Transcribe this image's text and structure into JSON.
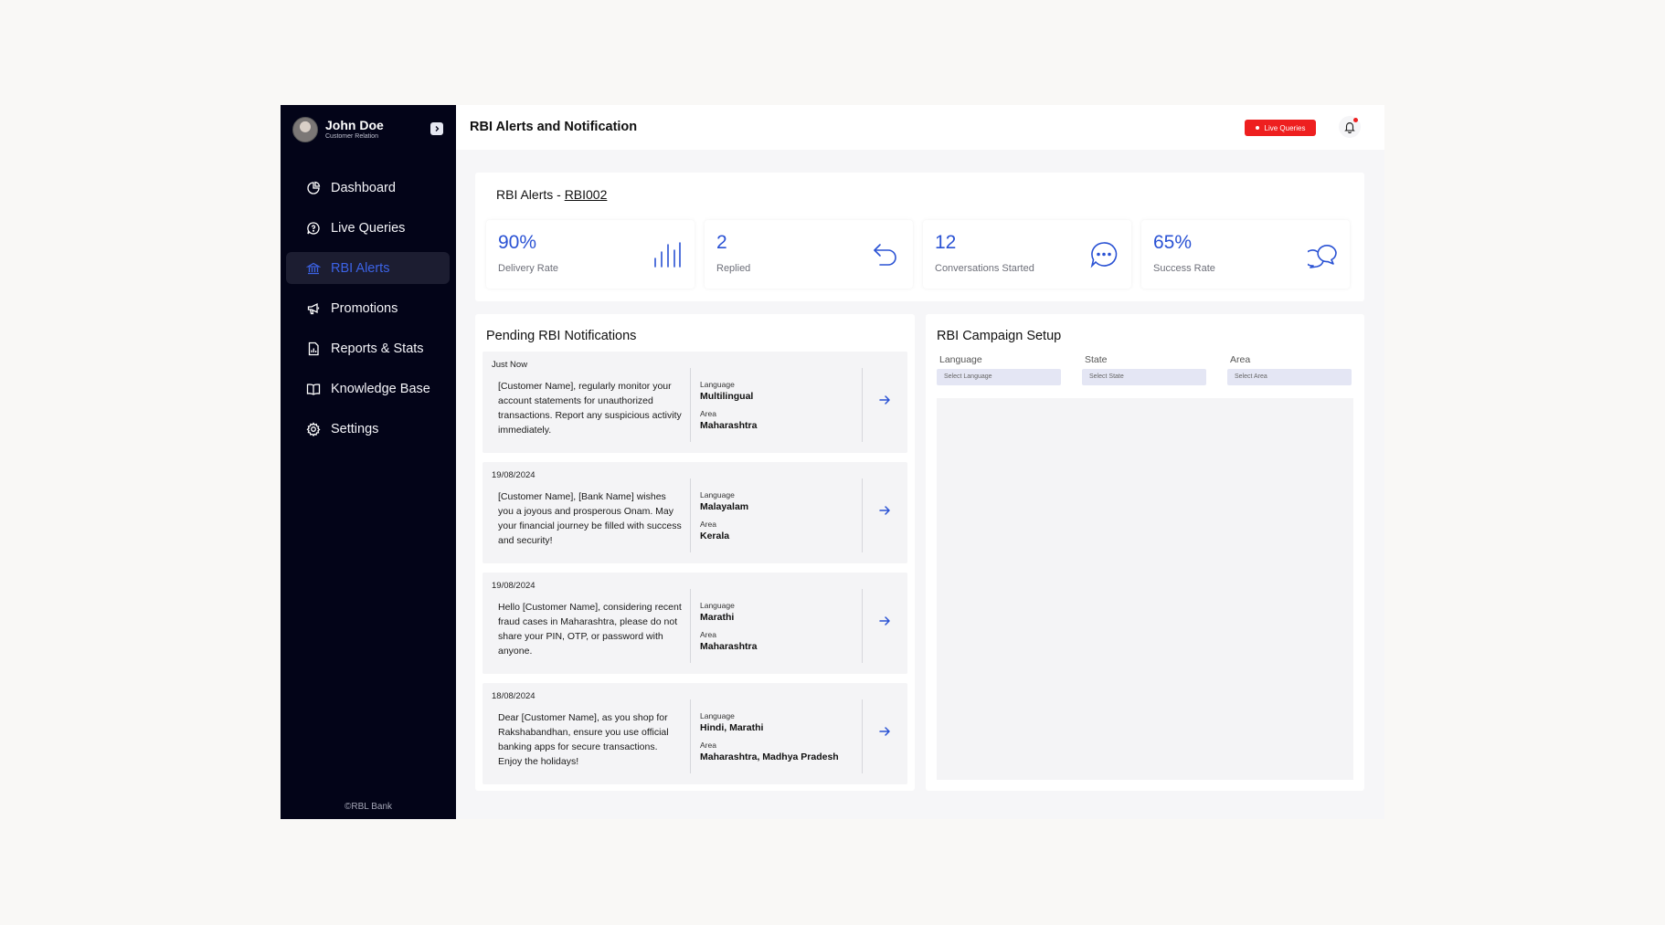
{
  "user": {
    "name": "John Doe",
    "role": "Customer Relation"
  },
  "nav": [
    {
      "label": "Dashboard",
      "icon": "pie-chart-icon"
    },
    {
      "label": "Live Queries",
      "icon": "chat-question-icon"
    },
    {
      "label": "RBI Alerts",
      "icon": "bank-icon",
      "active": true
    },
    {
      "label": "Promotions",
      "icon": "megaphone-icon"
    },
    {
      "label": "Reports & Stats",
      "icon": "report-icon"
    },
    {
      "label": "Knowledge Base",
      "icon": "book-icon"
    },
    {
      "label": "Settings",
      "icon": "gear-icon"
    }
  ],
  "footer": "©RBL Bank",
  "header": {
    "title": "RBI Alerts and Notification",
    "live_badge": "Live Queries"
  },
  "alerts": {
    "title_prefix": "RBI Alerts - ",
    "code": "RBI002",
    "stats": [
      {
        "value": "90%",
        "label": "Delivery Rate",
        "icon": "bar-chart-icon"
      },
      {
        "value": "2",
        "label": "Replied",
        "icon": "reply-icon"
      },
      {
        "value": "12",
        "label": "Conversations Started",
        "icon": "chat-bubble-icon"
      },
      {
        "value": "65%",
        "label": "Success Rate",
        "icon": "chat-bubbles-icon"
      }
    ]
  },
  "pending": {
    "title": "Pending RBI Notifications",
    "language_label": "Language",
    "area_label": "Area",
    "items": [
      {
        "date": "Just Now",
        "message": "[Customer Name], regularly monitor your account statements for unauthorized transactions. Report any suspicious activity immediately.",
        "language": "Multilingual",
        "area": "Maharashtra"
      },
      {
        "date": "19/08/2024",
        "message": "[Customer Name], [Bank Name] wishes you a joyous and prosperous Onam. May your financial journey be filled with success and security!",
        "language": "Malayalam",
        "area": "Kerala"
      },
      {
        "date": "19/08/2024",
        "message": "Hello [Customer Name], considering recent fraud cases in Maharashtra, please do not share your PIN, OTP, or password with anyone.",
        "language": "Marathi",
        "area": "Maharashtra"
      },
      {
        "date": "18/08/2024",
        "message": "Dear [Customer Name], as you shop for Rakshabandhan, ensure you use official banking apps for secure transactions. Enjoy the holidays!",
        "language": "Hindi, Marathi",
        "area": "Maharashtra, Madhya Pradesh"
      }
    ]
  },
  "campaign": {
    "title": "RBI Campaign Setup",
    "fields": [
      {
        "label": "Language",
        "placeholder": "Select Language"
      },
      {
        "label": "State",
        "placeholder": "Select State"
      },
      {
        "label": "Area",
        "placeholder": "Select Area"
      }
    ]
  },
  "colors": {
    "sidebar": "#030418",
    "accent": "#2a52d4",
    "live": "#ee1f1f"
  }
}
